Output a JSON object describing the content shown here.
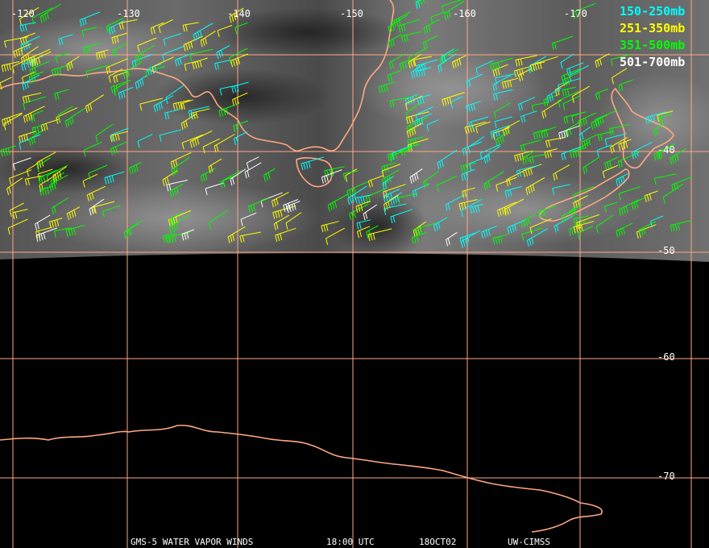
{
  "map": {
    "longitude_labels": [
      "-120",
      "-130",
      "-140",
      "-150",
      "-160",
      "-170"
    ],
    "latitude_labels": [
      "-40",
      "-50",
      "-60",
      "-70"
    ],
    "legend": [
      {
        "label": "150-250mb",
        "color": "#00ffff"
      },
      {
        "label": "251-350mb",
        "color": "#ffff00"
      },
      {
        "label": "351-500mb",
        "color": "#00ff00"
      },
      {
        "label": "501-700mb",
        "color": "#ffffff"
      }
    ],
    "footer": {
      "satellite": "GMS-5 WATER VAPOR WINDS",
      "time": "18:00 UTC",
      "date": "18OCT02",
      "source": "UW-CIMSS"
    },
    "colors": {
      "grid": "#ffa882",
      "coast": "#ffa882",
      "background": "#000000"
    }
  }
}
